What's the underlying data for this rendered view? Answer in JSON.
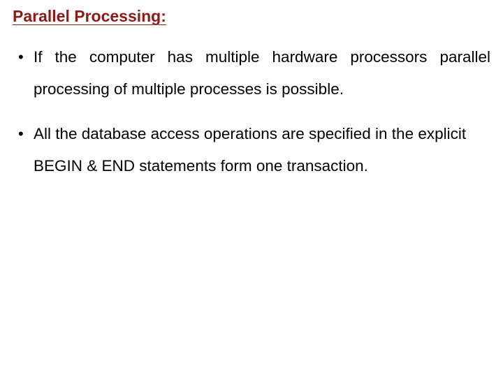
{
  "slide": {
    "title": "Parallel Processing:",
    "bullets": [
      "If the computer has multiple hardware processors parallel processing of multiple processes is possible.",
      "All the  database access operations are specified in the explicit BEGIN & END statements form one transaction."
    ]
  }
}
